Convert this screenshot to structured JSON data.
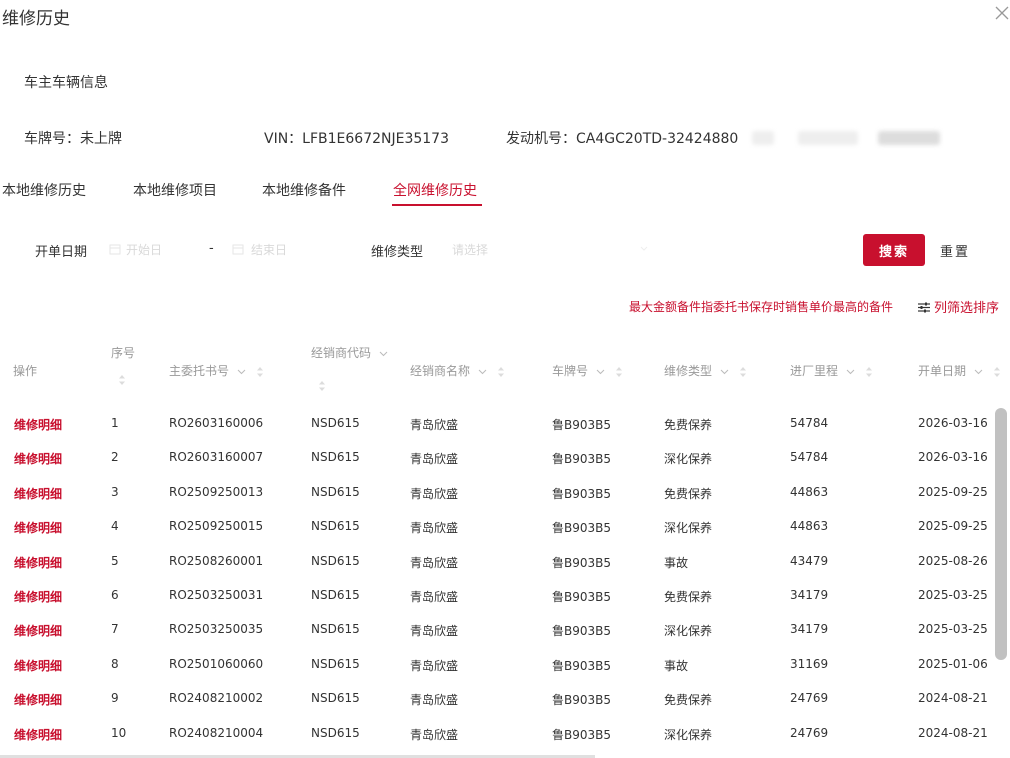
{
  "dialog": {
    "title": "维修历史"
  },
  "vehicle_info": {
    "section_title": "车主车辆信息",
    "plate": "车牌号：未上牌",
    "vin": "VIN：LFB1E6672NJE35173",
    "engine": "发动机号：CA4GC20TD-32424880"
  },
  "tabs": [
    {
      "label": "本地维修历史"
    },
    {
      "label": "本地维修项目"
    },
    {
      "label": "本地维修备件"
    },
    {
      "label": "全网维修历史",
      "active": true
    }
  ],
  "filters": {
    "date_label": "开单日期",
    "start_placeholder": "开始日",
    "range_sep": "-",
    "end_placeholder": "结束日",
    "type_label": "维修类型",
    "type_placeholder": "请选择",
    "search_label": "搜索",
    "reset_label": "重置"
  },
  "notice": "最大金额备件指委托书保存时销售单价最高的备件",
  "column_filter_label": "列筛选排序",
  "table": {
    "headers": [
      "操作",
      "序号",
      "主委托书号",
      "经销商代码",
      "经销商名称",
      "车牌号",
      "维修类型",
      "进厂里程",
      "开单日期"
    ],
    "rows": [
      [
        "维修明细",
        "1",
        "RO2603160006",
        "NSD615",
        "青岛欣盛",
        "鲁B903B5",
        "免费保养",
        "54784",
        "2026-03-16"
      ],
      [
        "维修明细",
        "2",
        "RO2603160007",
        "NSD615",
        "青岛欣盛",
        "鲁B903B5",
        "深化保养",
        "54784",
        "2026-03-16"
      ],
      [
        "维修明细",
        "3",
        "RO2509250013",
        "NSD615",
        "青岛欣盛",
        "鲁B903B5",
        "免费保养",
        "44863",
        "2025-09-25"
      ],
      [
        "维修明细",
        "4",
        "RO2509250015",
        "NSD615",
        "青岛欣盛",
        "鲁B903B5",
        "深化保养",
        "44863",
        "2025-09-25"
      ],
      [
        "维修明细",
        "5",
        "RO2508260001",
        "NSD615",
        "青岛欣盛",
        "鲁B903B5",
        "事故",
        "43479",
        "2025-08-26"
      ],
      [
        "维修明细",
        "6",
        "RO2503250031",
        "NSD615",
        "青岛欣盛",
        "鲁B903B5",
        "免费保养",
        "34179",
        "2025-03-25"
      ],
      [
        "维修明细",
        "7",
        "RO2503250035",
        "NSD615",
        "青岛欣盛",
        "鲁B903B5",
        "深化保养",
        "34179",
        "2025-03-25"
      ],
      [
        "维修明细",
        "8",
        "RO2501060060",
        "NSD615",
        "青岛欣盛",
        "鲁B903B5",
        "事故",
        "31169",
        "2025-01-06"
      ],
      [
        "维修明细",
        "9",
        "RO2408210002",
        "NSD615",
        "青岛欣盛",
        "鲁B903B5",
        "免费保养",
        "24769",
        "2024-08-21"
      ],
      [
        "维修明细",
        "10",
        "RO2408210004",
        "NSD615",
        "青岛欣盛",
        "鲁B903B5",
        "深化保养",
        "24769",
        "2024-08-21"
      ]
    ]
  },
  "colors": {
    "accent": "#c8102e",
    "header_text": "#999999",
    "text": "#333333"
  }
}
